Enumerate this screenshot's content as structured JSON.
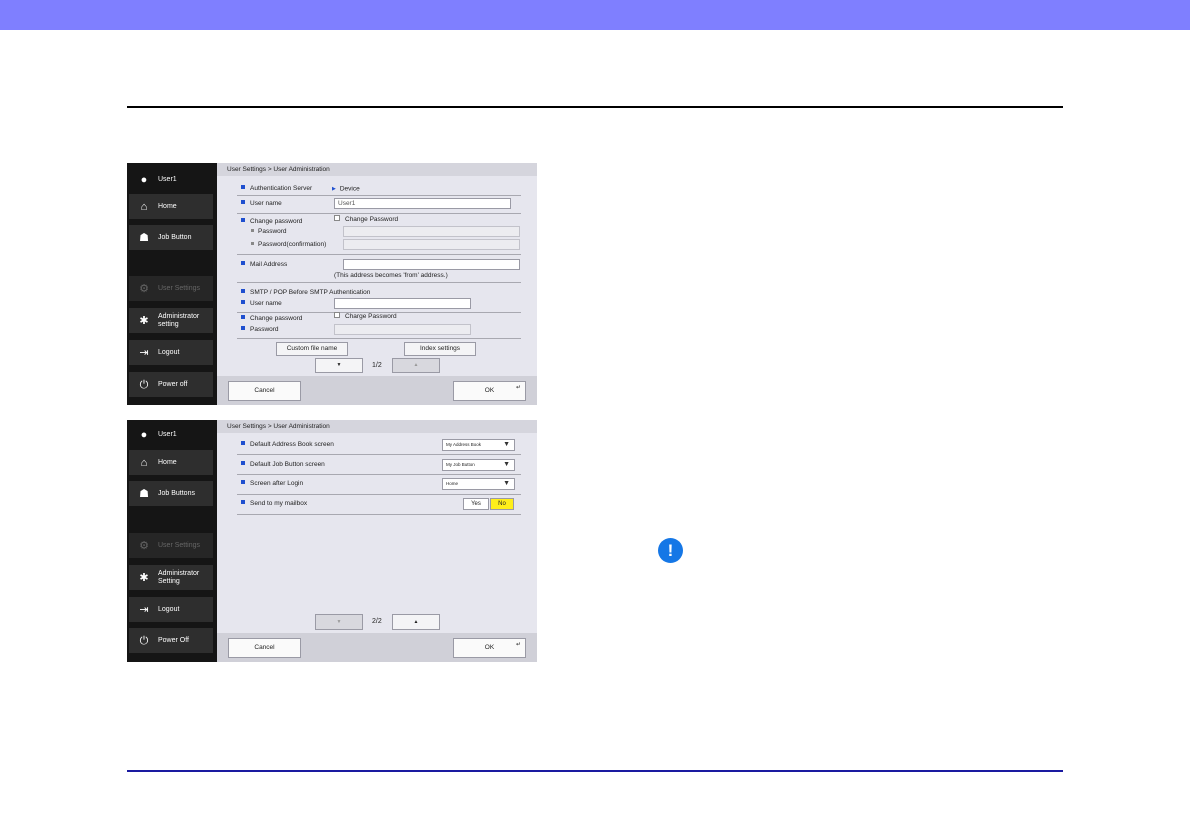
{
  "page": {
    "alert_icon": "exclamation-icon",
    "colors": {
      "header": "#7f7fff",
      "accent": "#1f4fcf",
      "alert": "#1577e6"
    }
  },
  "shot1": {
    "sidebar": {
      "user": "User1",
      "home": "Home",
      "job": "Job Button",
      "user_settings": "User Settings",
      "admin_line1": "Administrator",
      "admin_line2": "setting",
      "logout": "Logout",
      "power": "Power off"
    },
    "breadcrumb": "User Settings > User Administration",
    "auth_label": "Authentication Server",
    "auth_value": "Device",
    "username_label": "User name",
    "username_value": "User1",
    "change_pw_label": "Change password",
    "change_pw_check": "Change Password",
    "password_label": "Password",
    "password_confirm_label": "Password(confirmation)",
    "mail_label": "Mail Address",
    "mail_note": "(This address becomes 'from' address.)",
    "smtp_heading": "SMTP / POP Before SMTP Authentication",
    "smtp_username_label": "User name",
    "smtp_change_pw_label": "Change password",
    "smtp_change_pw_check": "Charge Password",
    "smtp_password_label": "Password",
    "custom_file_btn": "Custom file name",
    "index_btn": "Index settings",
    "down_arrow": "▼",
    "up_arrow": "▲",
    "page": "1/2",
    "cancel": "Cancel",
    "ok": "OK"
  },
  "shot2": {
    "sidebar": {
      "user": "User1",
      "home": "Home",
      "job": "Job Buttons",
      "user_settings": "User Settings",
      "admin_line1": "Administrator",
      "admin_line2": "Setting",
      "logout": "Logout",
      "power": "Power Off"
    },
    "breadcrumb": "User Settings > User Administration",
    "default_address_label": "Default Address Book screen",
    "default_address_value": "My Address Book",
    "default_job_label": "Default Job Button screen",
    "default_job_value": "My Job Button",
    "screen_after_login_label": "Screen after Login",
    "screen_after_login_value": "Home",
    "send_mailbox_label": "Send to my mailbox",
    "yes": "Yes",
    "no": "No",
    "down_arrow": "▼",
    "up_arrow": "▲",
    "page": "2/2",
    "cancel": "Cancel",
    "ok": "OK"
  }
}
